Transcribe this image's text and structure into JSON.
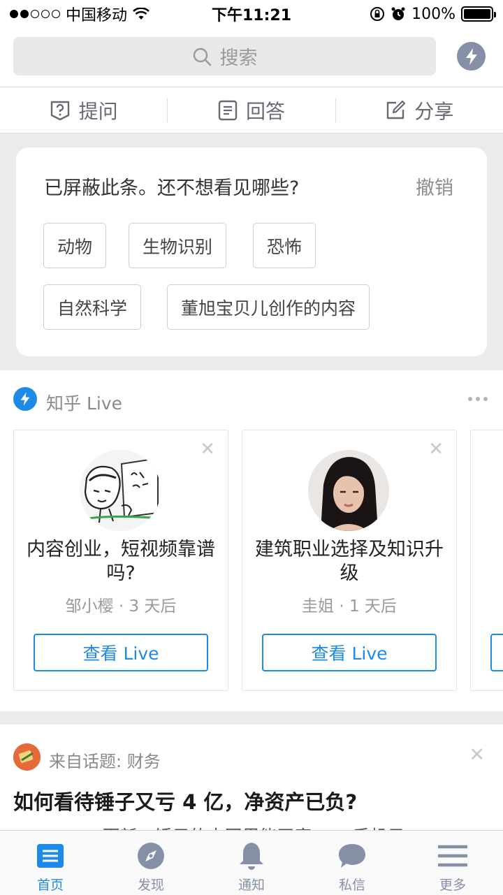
{
  "status_bar": {
    "carrier": "中国移动",
    "time": "下午11:21",
    "battery": "100%",
    "battery_level": 1.0
  },
  "search": {
    "placeholder": "搜索"
  },
  "actions": [
    {
      "label": "提问",
      "icon": "question-icon"
    },
    {
      "label": "回答",
      "icon": "document-icon"
    },
    {
      "label": "分享",
      "icon": "edit-icon"
    }
  ],
  "blocked": {
    "title": "已屏蔽此条。还不想看见哪些?",
    "undo": "撤销",
    "tags": [
      "动物",
      "生物识别",
      "恐怖",
      "自然科学",
      "董旭宝贝儿创作的内容"
    ]
  },
  "live": {
    "header": "知乎 Live",
    "cards": [
      {
        "title": "内容创业，短视频靠谱吗?",
        "author": "邹小樱",
        "time": "3 天后",
        "meta": "邹小樱 · 3 天后",
        "button": "查看 Live"
      },
      {
        "title": "建筑职业选择及知识升级",
        "author": "圭姐",
        "time": "1 天后",
        "meta": "圭姐 · 1 天后",
        "button": "查看 Live"
      }
    ]
  },
  "feed": {
    "topic": "来自话题: 财务",
    "title": "如何看待锤子又亏 4 亿，净资产已负?",
    "excerpt": "TED LEE · 更新，锤子的中国里能司家…… 手机目"
  },
  "tabs": [
    {
      "label": "首页",
      "icon": "home-icon",
      "active": true
    },
    {
      "label": "发现",
      "icon": "compass-icon",
      "active": false
    },
    {
      "label": "通知",
      "icon": "bell-icon",
      "active": false
    },
    {
      "label": "私信",
      "icon": "chat-bubble-icon",
      "active": false
    },
    {
      "label": "更多",
      "icon": "menu-icon",
      "active": false
    }
  ],
  "colors": {
    "accent": "#1e8ae8",
    "icon_gray": "#8590a6",
    "background": "#ebebeb"
  }
}
